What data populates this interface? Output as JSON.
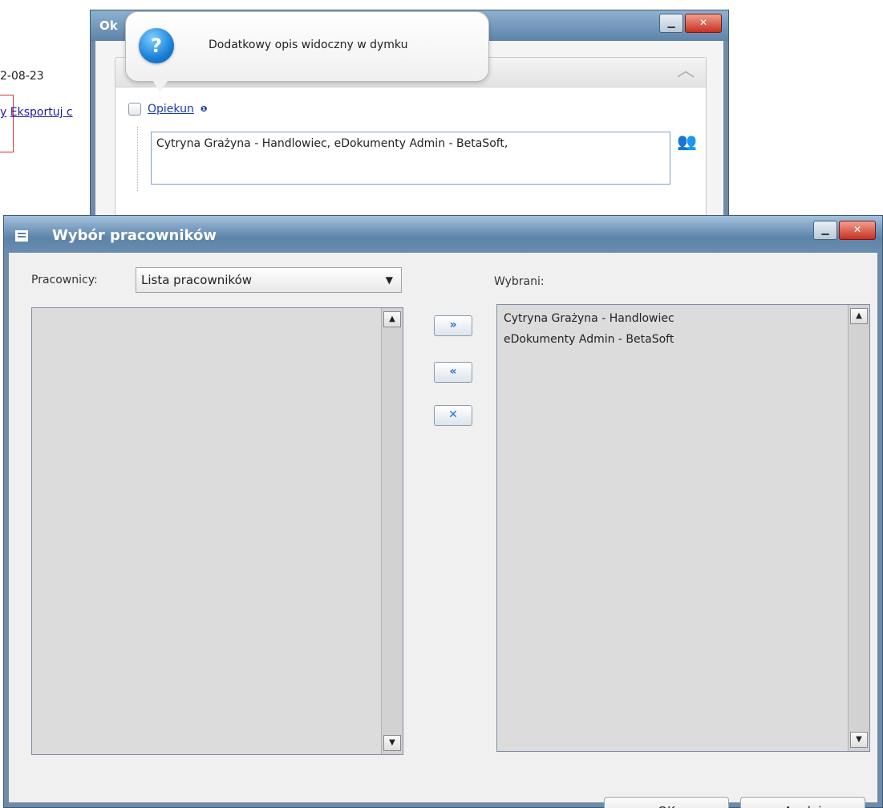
{
  "background_page": {
    "date_fragment": "2-08-23",
    "link_fragment_1": "y",
    "link_fragment_2": "Eksportuj c"
  },
  "back_window": {
    "title": "Ok",
    "minimize_label": "▁",
    "close_label": "✕",
    "collapse_icon": "︿",
    "opiekun_label": "Opiekun",
    "info_marker": "❶",
    "opiekun_value": "Cytryna Grażyna - Handlowiec,  eDokumenty Admin - BetaSoft,",
    "pick_icon": "👥"
  },
  "tooltip": {
    "icon": "?",
    "text": "Dodatkowy opis widoczny w dymku"
  },
  "dialog": {
    "title": "Wybór pracowników",
    "minimize_label": "▁",
    "close_label": "✕",
    "pracownicy_label": "Pracownicy:",
    "select_value": "Lista pracowników",
    "select_arrow": "▼",
    "wybrani_label": "Wybrani:",
    "available_items": [],
    "selected_items": [
      "Cytryna Grażyna - Handlowiec",
      "eDokumenty Admin - BetaSoft"
    ],
    "add_all_icon": "»",
    "remove_all_icon": "«",
    "clear_icon": "✕",
    "scroll_up": "▲",
    "scroll_down": "▼",
    "ok_label": "OK",
    "cancel_label": "Anuluj"
  }
}
